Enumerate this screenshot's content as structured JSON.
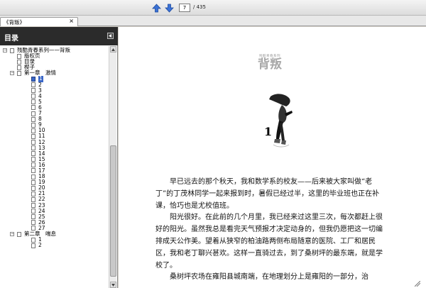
{
  "toolbar": {
    "up_icon": "arrow-up-icon",
    "down_icon": "arrow-down-icon",
    "page_current": "7",
    "page_total": "/ 435"
  },
  "tab": {
    "title": "《背叛》",
    "close": "×"
  },
  "sidebar": {
    "title": "目录",
    "root": "残酷青春系列——背叛",
    "items": [
      {
        "label": "版权页",
        "level": 1,
        "expander": "",
        "page": false
      },
      {
        "label": "目录",
        "level": 1,
        "expander": "",
        "page": false
      },
      {
        "label": "楔子",
        "level": 1,
        "expander": "",
        "page": false
      },
      {
        "label": "第一章　激情",
        "level": 1,
        "expander": "−",
        "page": false
      },
      {
        "label": "1",
        "level": 2,
        "expander": "",
        "page": true,
        "selected": true
      },
      {
        "label": "2",
        "level": 2,
        "expander": "",
        "page": true
      },
      {
        "label": "3",
        "level": 2,
        "expander": "",
        "page": true
      },
      {
        "label": "4",
        "level": 2,
        "expander": "",
        "page": true
      },
      {
        "label": "5",
        "level": 2,
        "expander": "",
        "page": true
      },
      {
        "label": "6",
        "level": 2,
        "expander": "",
        "page": true
      },
      {
        "label": "7",
        "level": 2,
        "expander": "",
        "page": true
      },
      {
        "label": "8",
        "level": 2,
        "expander": "",
        "page": true
      },
      {
        "label": "9",
        "level": 2,
        "expander": "",
        "page": true
      },
      {
        "label": "10",
        "level": 2,
        "expander": "",
        "page": true
      },
      {
        "label": "11",
        "level": 2,
        "expander": "",
        "page": true
      },
      {
        "label": "12",
        "level": 2,
        "expander": "",
        "page": true
      },
      {
        "label": "13",
        "level": 2,
        "expander": "",
        "page": true
      },
      {
        "label": "14",
        "level": 2,
        "expander": "",
        "page": true
      },
      {
        "label": "15",
        "level": 2,
        "expander": "",
        "page": true
      },
      {
        "label": "16",
        "level": 2,
        "expander": "",
        "page": true
      },
      {
        "label": "17",
        "level": 2,
        "expander": "",
        "page": true
      },
      {
        "label": "18",
        "level": 2,
        "expander": "",
        "page": true
      },
      {
        "label": "19",
        "level": 2,
        "expander": "",
        "page": true
      },
      {
        "label": "20",
        "level": 2,
        "expander": "",
        "page": true
      },
      {
        "label": "21",
        "level": 2,
        "expander": "",
        "page": true
      },
      {
        "label": "22",
        "level": 2,
        "expander": "",
        "page": true
      },
      {
        "label": "23",
        "level": 2,
        "expander": "",
        "page": true
      },
      {
        "label": "24",
        "level": 2,
        "expander": "",
        "page": true
      },
      {
        "label": "25",
        "level": 2,
        "expander": "",
        "page": true
      },
      {
        "label": "26",
        "level": 2,
        "expander": "",
        "page": true
      },
      {
        "label": "27",
        "level": 2,
        "expander": "",
        "page": true
      },
      {
        "label": "第二章　喘息",
        "level": 1,
        "expander": "−",
        "page": false
      },
      {
        "label": "1",
        "level": 2,
        "expander": "",
        "page": true
      },
      {
        "label": "2",
        "level": 2,
        "expander": "",
        "page": true
      }
    ]
  },
  "document": {
    "series_small": "残酷青春系列",
    "series_big": "背叛",
    "chapter_number": "1",
    "paragraphs": [
      {
        "text": "早已远去的那个秋天，我和数学系的校友——后来被大家叫做“老丁”的丁茂林同学一起来报到时，暑假已经过半，这里的毕业班也正在补课，恰巧也是尤校值班。",
        "indent": true
      },
      {
        "text": "阳光很好。在此前的几个月里，我已经来过这里三次，每次都赶上很好的阳光。虽然我总是看完天气预报才决定动身的，但我仍愿把这一切编排成天公作美。望着从狭窄的柏油路两侧布局随意的医院、工厂和居民区，我和老丁聊兴甚欢。这样一直骑过去，到了桑树坪的最东端，就是学校了。",
        "indent": true
      },
      {
        "text": "桑树坪农场在雍阳县城南端，在地理划分上是雍阳的一部分，治",
        "indent": true
      }
    ]
  },
  "colors": {
    "sidebar_header": "#2b2b2b",
    "selection": "#3a67c8",
    "nav_arrow": "#3b72d6"
  }
}
